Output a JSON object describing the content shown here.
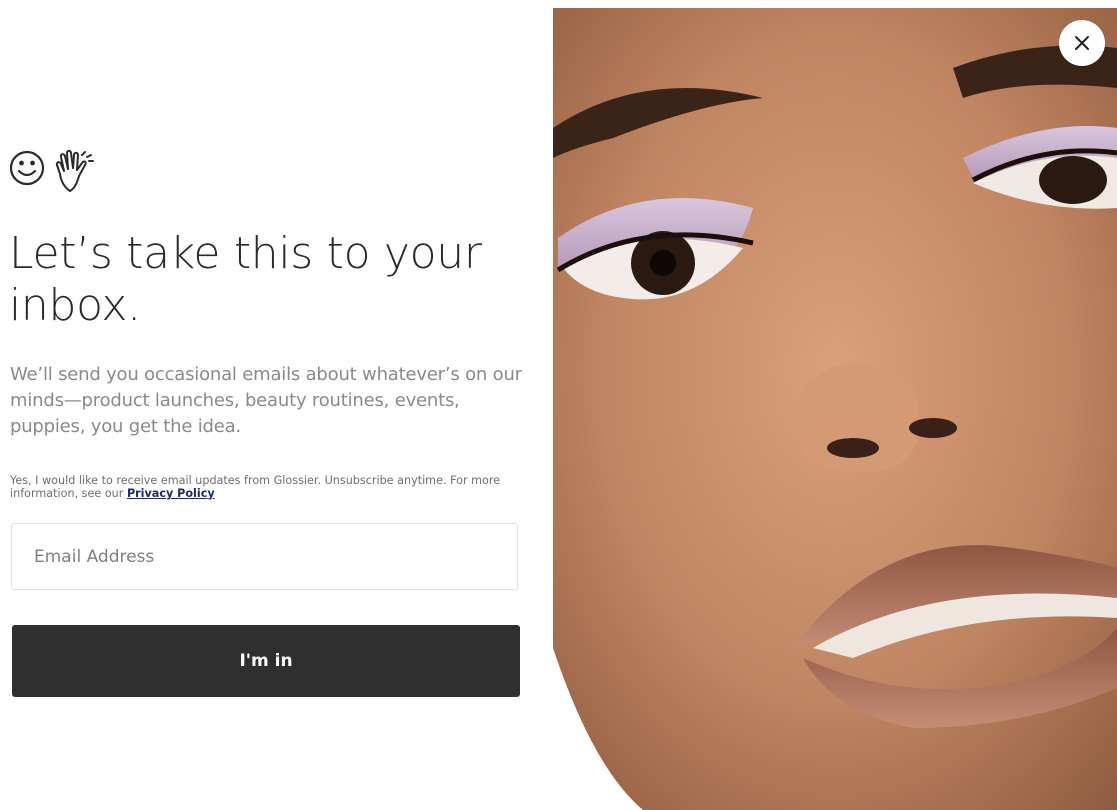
{
  "headline": "Let’s take this to your inbox.",
  "body": "We’ll send you occasional emails about whatever’s on our minds—product launches, beauty routines, events, puppies, you get the idea.",
  "consent": {
    "text": "Yes, I would like to receive email updates from Glossier. Unsubscribe anytime. For more information, see our",
    "link_label": "Privacy Policy"
  },
  "email": {
    "placeholder": "Email Address",
    "value": ""
  },
  "submit_label": "I'm in",
  "icons": {
    "decor": [
      "smiley-face-icon",
      "waving-hand-icon"
    ],
    "close": "close-icon"
  }
}
